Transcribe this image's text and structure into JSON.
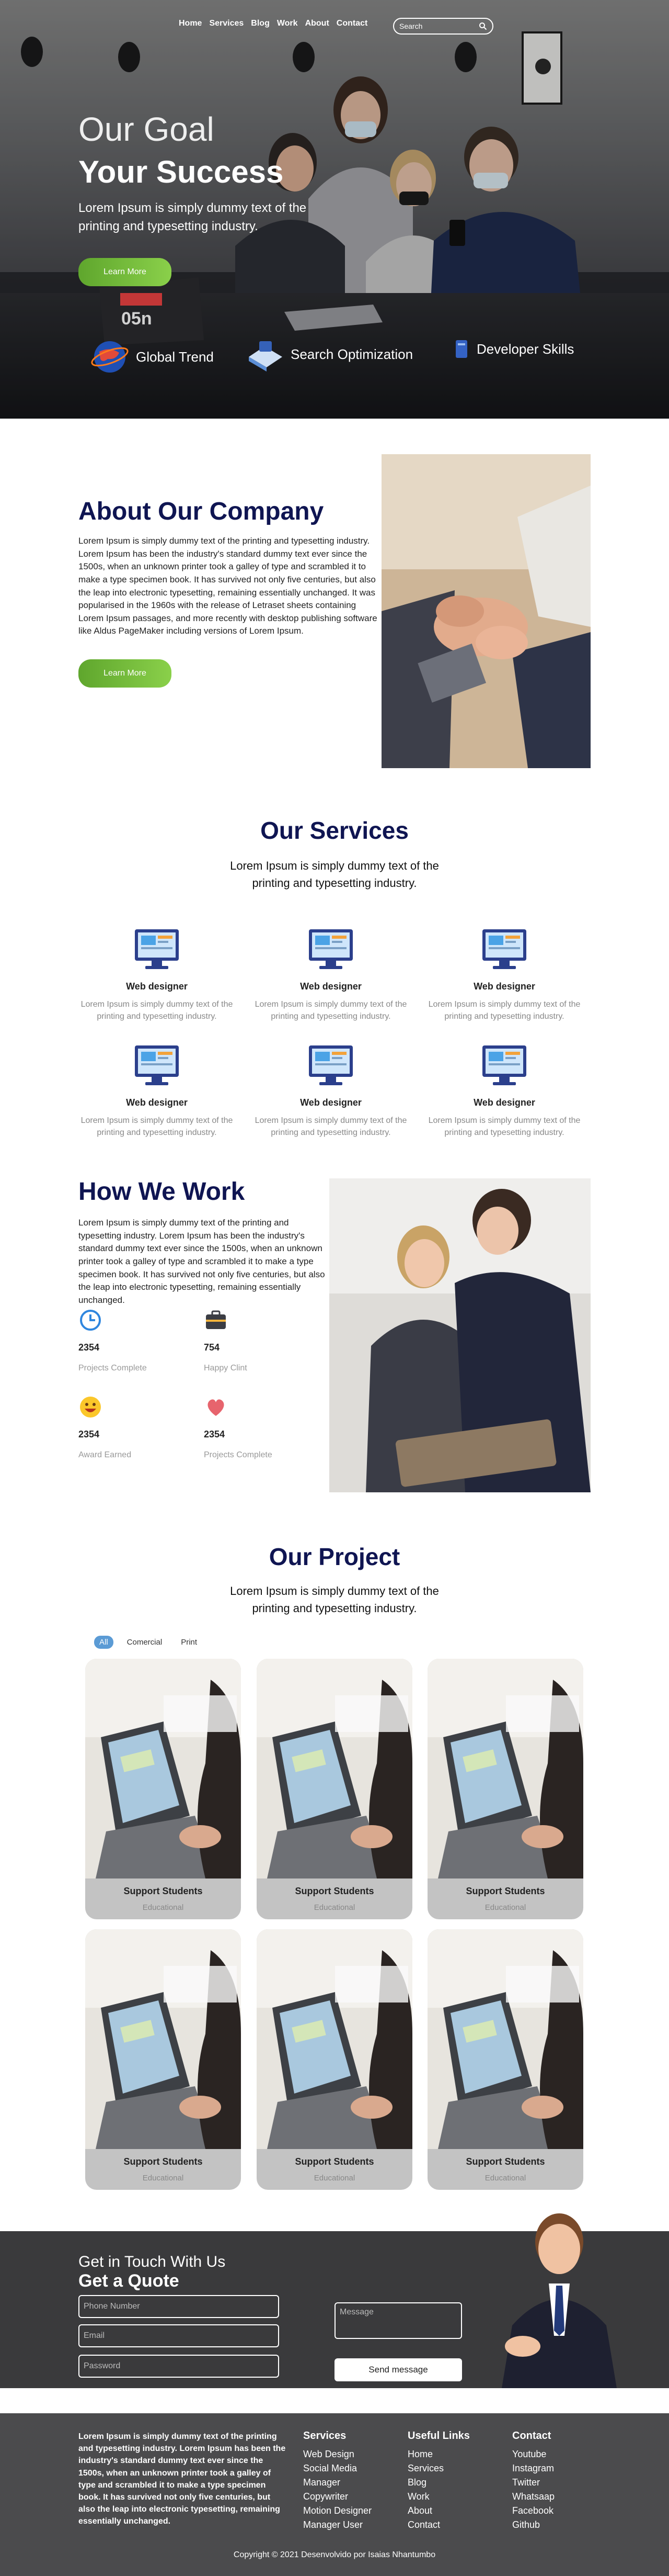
{
  "nav": {
    "items": [
      "Home",
      "Services",
      "Blog",
      "Work",
      "About",
      "Contact"
    ],
    "search_placeholder": "Search"
  },
  "hero": {
    "line1": "Our Goal",
    "line2": "Your Success",
    "line3": "Lorem Ipsum is simply dummy text of the printing and typesetting industry.",
    "button": "Learn More",
    "features": [
      "Global Trend",
      "Search Optimization",
      "Developer Skills"
    ]
  },
  "about": {
    "title": "About Our Company",
    "text": "Lorem Ipsum is simply dummy text of the printing and typesetting industry. Lorem Ipsum has been the industry's standard dummy text ever since the 1500s, when an unknown printer took a galley of type and scrambled it to make a type specimen book. It has survived not only five centuries, but also the leap into electronic typesetting, remaining essentially unchanged. It was popularised in the 1960s with the release of Letraset sheets containing Lorem Ipsum passages, and more recently with desktop publishing software like Aldus PageMaker including versions of Lorem Ipsum.",
    "button": "Learn More"
  },
  "services": {
    "title": "Our Services",
    "subtitle": "Lorem Ipsum is simply dummy text of the printing and typesetting industry.",
    "items": [
      {
        "title": "Web designer",
        "text": "Lorem Ipsum is simply dummy text of the printing and typesetting industry."
      },
      {
        "title": "Web designer",
        "text": "Lorem Ipsum is simply dummy text of the printing and typesetting industry."
      },
      {
        "title": "Web designer",
        "text": "Lorem Ipsum is simply dummy text of the printing and typesetting industry."
      },
      {
        "title": "Web designer",
        "text": "Lorem Ipsum is simply dummy text of the printing and typesetting industry."
      },
      {
        "title": "Web designer",
        "text": "Lorem Ipsum is simply dummy text of the printing and typesetting industry."
      },
      {
        "title": "Web designer",
        "text": "Lorem Ipsum is simply dummy text of the printing and typesetting industry."
      }
    ]
  },
  "how": {
    "title": "How We Work",
    "text": "Lorem Ipsum is simply dummy text of the printing and typesetting industry. Lorem Ipsum has been the industry's standard dummy text ever since the 1500s, when an unknown printer took a galley of type and scrambled it to make a type specimen book. It has survived not only five centuries, but also the leap into electronic typesetting, remaining essentially unchanged.",
    "stats": [
      {
        "icon": "clock-icon",
        "value": "2354",
        "label": "Projects Complete"
      },
      {
        "icon": "briefcase-icon",
        "value": "754",
        "label": "Happy Clint"
      },
      {
        "icon": "smile-icon",
        "value": "2354",
        "label": "Award Earned"
      },
      {
        "icon": "heart-icon",
        "value": "2354",
        "label": "Projects Complete"
      }
    ]
  },
  "project": {
    "title": "Our Project",
    "subtitle": "Lorem Ipsum is simply dummy text of the printing and typesetting industry.",
    "filters": [
      "All",
      "Comercial",
      "Print"
    ],
    "cards": [
      {
        "title": "Support Students",
        "category": "Educational"
      },
      {
        "title": "Support Students",
        "category": "Educational"
      },
      {
        "title": "Support Students",
        "category": "Educational"
      },
      {
        "title": "Support Students",
        "category": "Educational"
      },
      {
        "title": "Support Students",
        "category": "Educational"
      },
      {
        "title": "Support Students",
        "category": "Educational"
      }
    ]
  },
  "contact": {
    "line1": "Get in Touch With Us",
    "line2": "Get a Quote",
    "phone_placeholder": "Phone Number",
    "email_placeholder": "Email",
    "password_placeholder": "Password",
    "message_placeholder": "Message",
    "send": "Send message"
  },
  "footer": {
    "desc": "Lorem Ipsum is simply dummy text of the printing and typesetting industry. Lorem Ipsum has been the industry's standard dummy text ever since the 1500s, when an unknown printer took a galley of type and scrambled it to make a type specimen book. It has survived not only five centuries, but also the leap into electronic typesetting, remaining essentially unchanged.",
    "cols": [
      {
        "title": "Services",
        "items": [
          "Web Design",
          "Social Media",
          "Manager",
          "Copywriter",
          "Motion Designer",
          "Manager User"
        ]
      },
      {
        "title": "Useful Links",
        "items": [
          "Home",
          "Services",
          "Blog",
          "Work",
          "About",
          "Contact"
        ]
      },
      {
        "title": "Contact",
        "items": [
          "Youtube",
          "Instagram",
          "Twitter",
          "Whatsaap",
          "Facebook",
          "Github"
        ]
      }
    ],
    "copyright": "Copyright © 2021 Desenvolvido por Isaias Nhantumbo"
  },
  "colors": {
    "navy": "#0f1552",
    "green": "#6cb83a",
    "contact_bg": "#3a3a3c",
    "footer_bg": "#4b4b4d"
  }
}
